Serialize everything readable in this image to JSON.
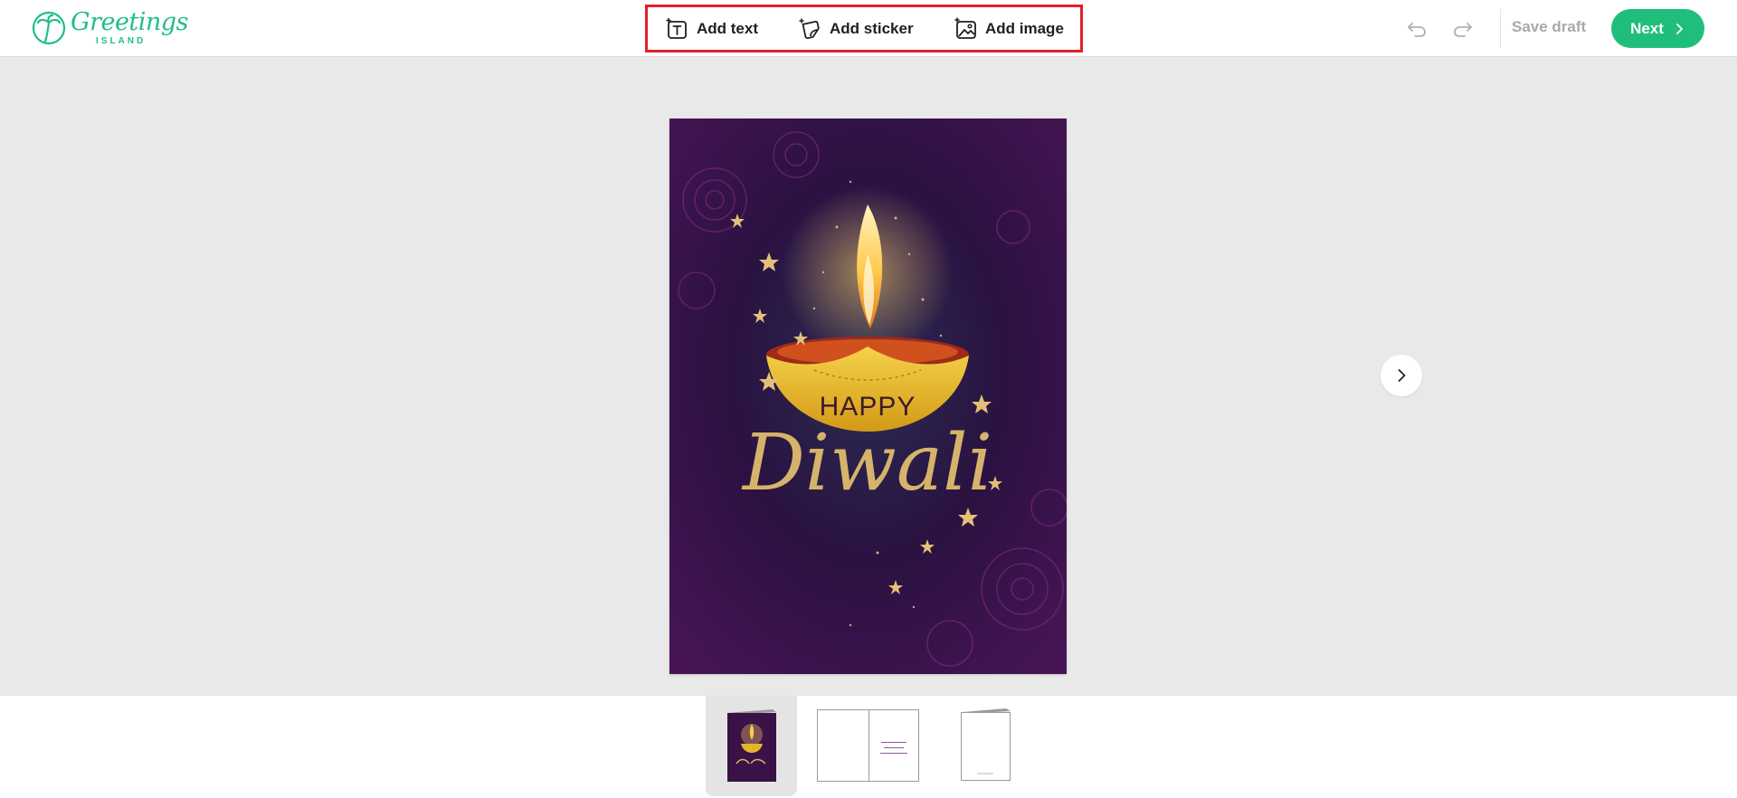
{
  "header": {
    "logo_name": "Greetings",
    "logo_sub": "ISLAND",
    "tools": [
      {
        "label": "Add text",
        "icon": "add-text-icon"
      },
      {
        "label": "Add sticker",
        "icon": "add-sticker-icon"
      },
      {
        "label": "Add image",
        "icon": "add-image-icon"
      }
    ],
    "save_draft_label": "Save draft",
    "next_label": "Next"
  },
  "card": {
    "line1": "HAPPY",
    "line2": "Diwali"
  },
  "colors": {
    "brand_green": "#1fbf7b",
    "highlight_red": "#e0202a",
    "card_purple": "#3a0f4a"
  },
  "thumbnails": {
    "selected_index": 0,
    "pages": [
      "front",
      "inside",
      "back"
    ]
  }
}
